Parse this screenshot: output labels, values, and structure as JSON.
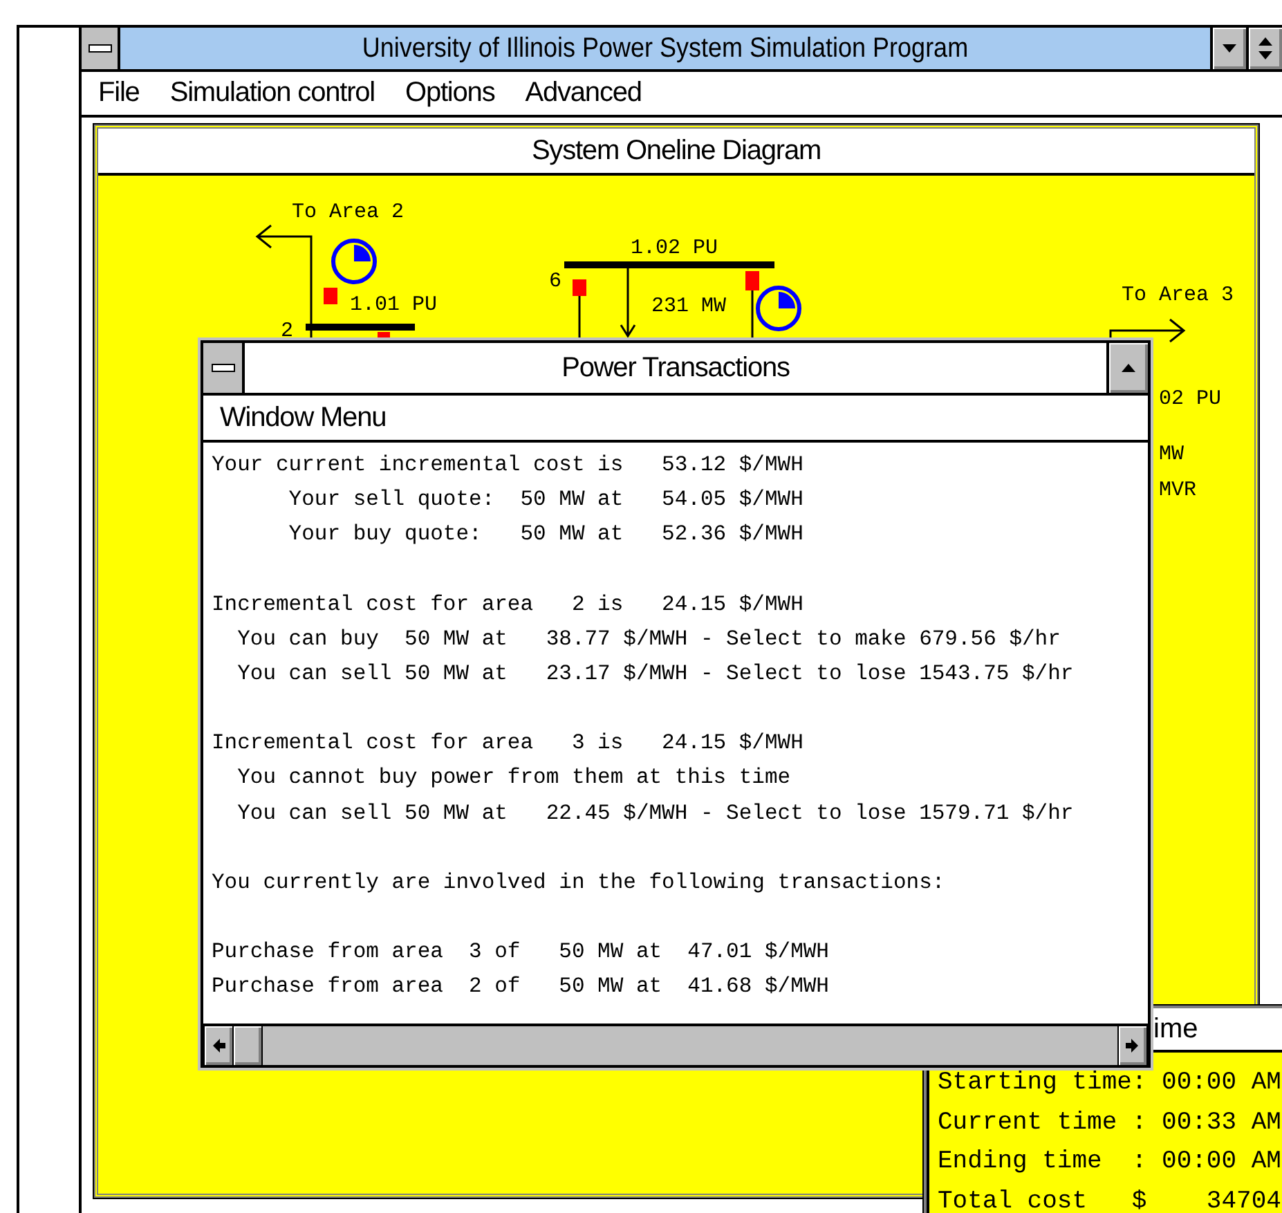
{
  "window": {
    "title": "University of Illinois Power System Simulation Program"
  },
  "menu": [
    "File",
    "Simulation control",
    "Options",
    "Advanced"
  ],
  "diagram_window": {
    "title": "System Oneline Diagram",
    "labels": [
      "To Area 2",
      "1.01 PU",
      "2",
      "1.02 PU",
      "6",
      "231 MW",
      "To Area 3",
      "02 PU",
      "MW",
      "MVR"
    ]
  },
  "transactions_window": {
    "title": "Power Transactions",
    "menu": "Window Menu",
    "paragraphs": [
      [
        "Your current incremental cost is   53.12 $/MWH",
        "      Your sell quote:  50 MW at   54.05 $/MWH",
        "      Your buy quote:   50 MW at   52.36 $/MWH"
      ],
      [
        "Incremental cost for area   2 is   24.15 $/MWH",
        "  You can buy  50 MW at   38.77 $/MWH - Select to make 679.56 $/hr",
        "  You can sell 50 MW at   23.17 $/MWH - Select to lose 1543.75 $/hr"
      ],
      [
        "Incremental cost for area   3 is   24.15 $/MWH",
        "  You cannot buy power from them at this time",
        "  You can sell 50 MW at   22.45 $/MWH - Select to lose 1579.71 $/hr"
      ],
      [
        "You currently are involved in the following transactions:"
      ],
      [
        "Purchase from area  3 of   50 MW at  47.01 $/MWH",
        "Purchase from area  2 of   50 MW at  41.68 $/MWH"
      ]
    ]
  },
  "time_window": {
    "title": "ime",
    "lines": [
      "Starting time: 00:00 AM",
      "Current time : 00:33 AM",
      "Ending time  : 00:00 AM",
      "Total cost   $    34704"
    ]
  }
}
